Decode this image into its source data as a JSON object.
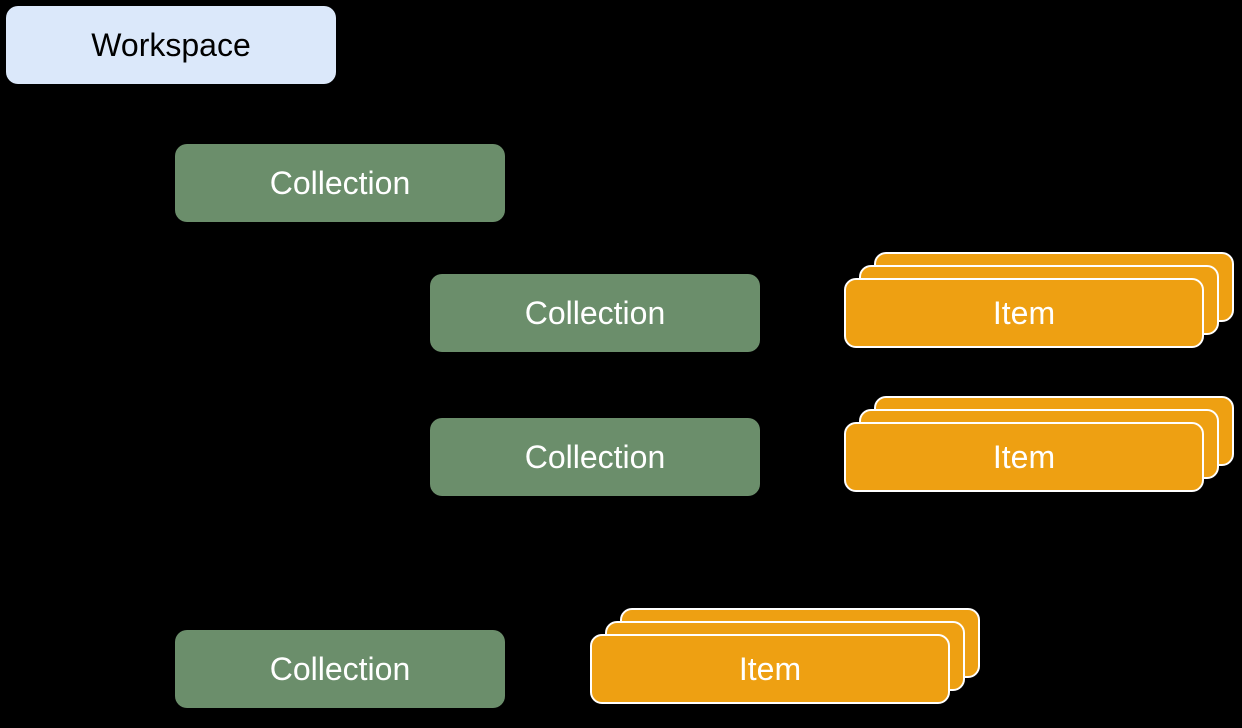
{
  "workspace": {
    "label": "Workspace"
  },
  "collections": {
    "c1": "Collection",
    "c2": "Collection",
    "c3": "Collection",
    "c4": "Collection"
  },
  "items": {
    "i1": "Item",
    "i2": "Item",
    "i3": "Item"
  },
  "colors": {
    "workspace_bg": "#dbe8fa",
    "collection_bg": "#6b8e6b",
    "item_bg": "#eea012"
  }
}
